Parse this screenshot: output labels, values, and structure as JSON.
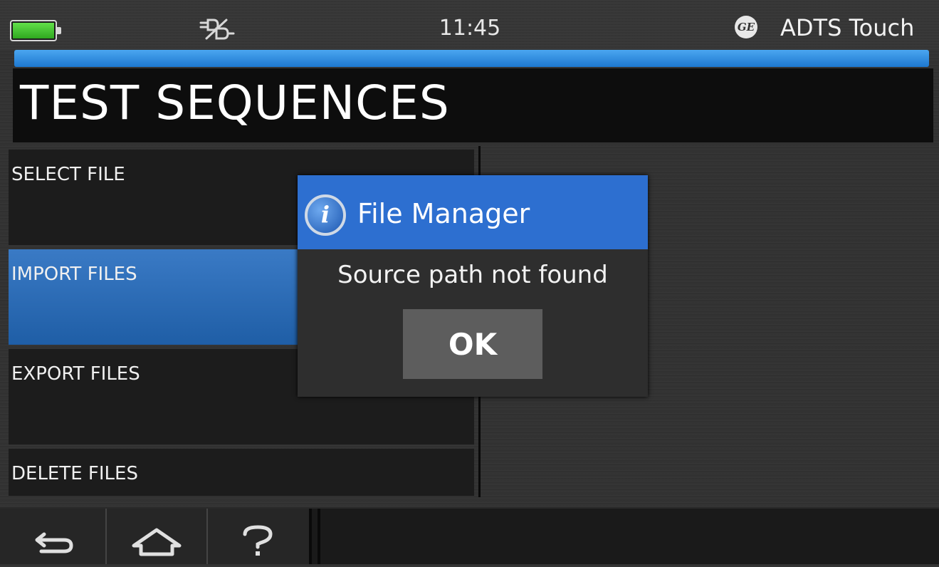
{
  "status": {
    "time": "11:45",
    "brand": "ADTS Touch",
    "logo_text": "GE"
  },
  "icons": {
    "battery": "battery-full-icon",
    "plug": "disconnected-plug-icon",
    "info": "info-icon",
    "back": "back-arrow-icon",
    "home": "home-icon",
    "help": "help-icon"
  },
  "page": {
    "title": "TEST SEQUENCES"
  },
  "menu": {
    "items": [
      {
        "label": "SELECT FILE",
        "active": false
      },
      {
        "label": "IMPORT FILES",
        "active": true
      },
      {
        "label": "EXPORT FILES",
        "active": false
      },
      {
        "label": "DELETE FILES",
        "active": false
      }
    ]
  },
  "dialog": {
    "title": "File Manager",
    "message": "Source path not found",
    "ok_label": "OK",
    "info_glyph": "i"
  },
  "colors": {
    "accent_blue": "#2d6fd0",
    "battery_green": "#3fcf2a"
  }
}
